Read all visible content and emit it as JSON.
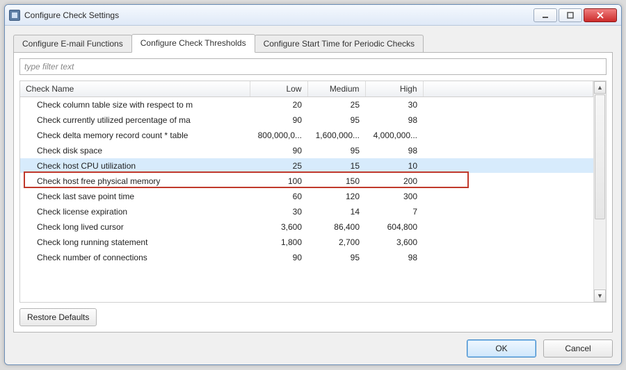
{
  "window": {
    "title": "Configure Check Settings"
  },
  "tabs": {
    "items": [
      {
        "label": "Configure E-mail Functions",
        "active": false
      },
      {
        "label": "Configure Check Thresholds",
        "active": true
      },
      {
        "label": "Configure Start Time for Periodic Checks",
        "active": false
      }
    ]
  },
  "filter": {
    "placeholder": "type filter text",
    "value": ""
  },
  "columns": {
    "name": "Check Name",
    "low": "Low",
    "medium": "Medium",
    "high": "High"
  },
  "rows": [
    {
      "name": "Check column table size with respect to m",
      "low": "20",
      "med": "25",
      "high": "30"
    },
    {
      "name": "Check currently utilized percentage of ma",
      "low": "90",
      "med": "95",
      "high": "98"
    },
    {
      "name": "Check delta memory record count * table",
      "low": "800,000,0...",
      "med": "1,600,000...",
      "high": "4,000,000..."
    },
    {
      "name": "Check disk space",
      "low": "90",
      "med": "95",
      "high": "98"
    },
    {
      "name": "Check host CPU utilization",
      "low": "25",
      "med": "15",
      "high": "10",
      "selected": true
    },
    {
      "name": "Check host free physical memory",
      "low": "100",
      "med": "150",
      "high": "200"
    },
    {
      "name": "Check last save point time",
      "low": "60",
      "med": "120",
      "high": "300"
    },
    {
      "name": "Check license expiration",
      "low": "30",
      "med": "14",
      "high": "7"
    },
    {
      "name": "Check long lived cursor",
      "low": "3,600",
      "med": "86,400",
      "high": "604,800"
    },
    {
      "name": "Check long running statement",
      "low": "1,800",
      "med": "2,700",
      "high": "3,600"
    },
    {
      "name": "Check number of connections",
      "low": "90",
      "med": "95",
      "high": "98"
    }
  ],
  "buttons": {
    "restore": "Restore Defaults",
    "ok": "OK",
    "cancel": "Cancel"
  }
}
